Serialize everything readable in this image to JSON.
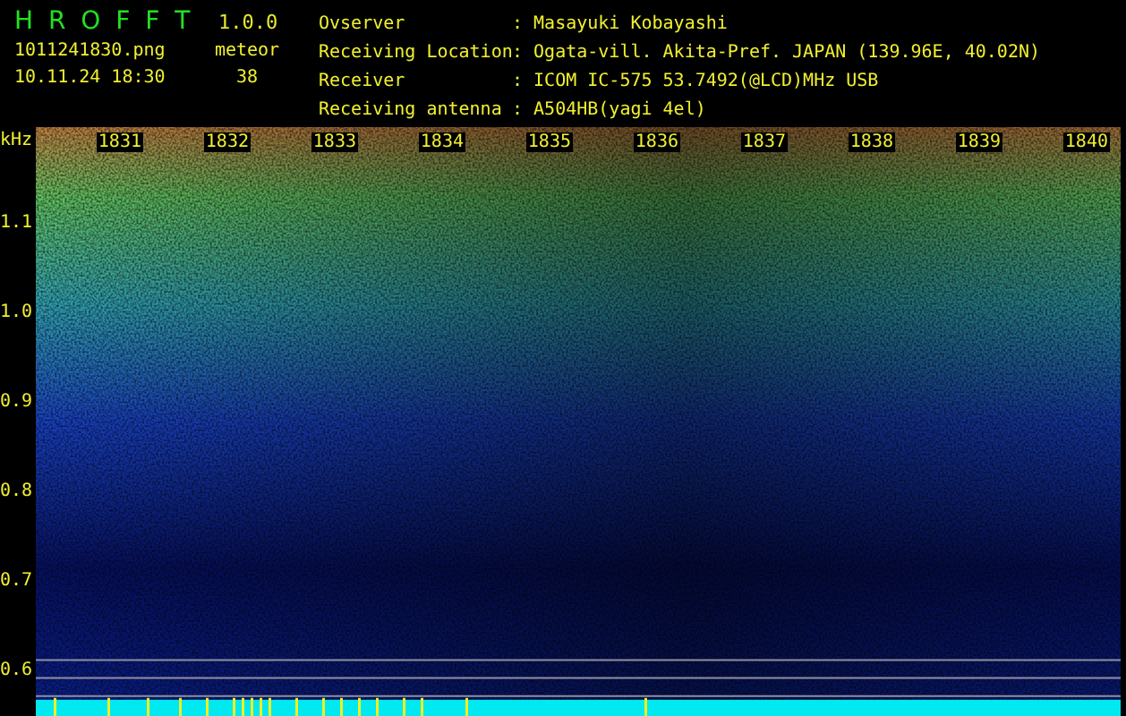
{
  "app": {
    "title": "H R O F F T",
    "version": "1.0.0"
  },
  "capture": {
    "file": "1011241830.png",
    "datetime": "10.11.24 18:30",
    "counter_label": "meteor",
    "count": "38"
  },
  "info": [
    {
      "label": "Ovserver",
      "value": ": Masayuki Kobayashi"
    },
    {
      "label": "Receiving Location",
      "value": ": Ogata-vill. Akita-Pref. JAPAN (139.96E, 40.02N)"
    },
    {
      "label": "Receiver",
      "value": ": ICOM IC-575 53.7492(@LCD)MHz USB"
    },
    {
      "label": "Receiving antenna",
      "value": ": A504HB(yagi 4el)"
    }
  ],
  "spectrogram": {
    "unit": "kHz",
    "y_labels": [
      "1.1",
      "1.0",
      "0.9",
      "0.8",
      "0.7",
      "0.6"
    ],
    "time_labels": [
      "1831",
      "1832",
      "1833",
      "1834",
      "1835",
      "1836",
      "1837",
      "1838",
      "1839",
      "1840"
    ]
  }
}
